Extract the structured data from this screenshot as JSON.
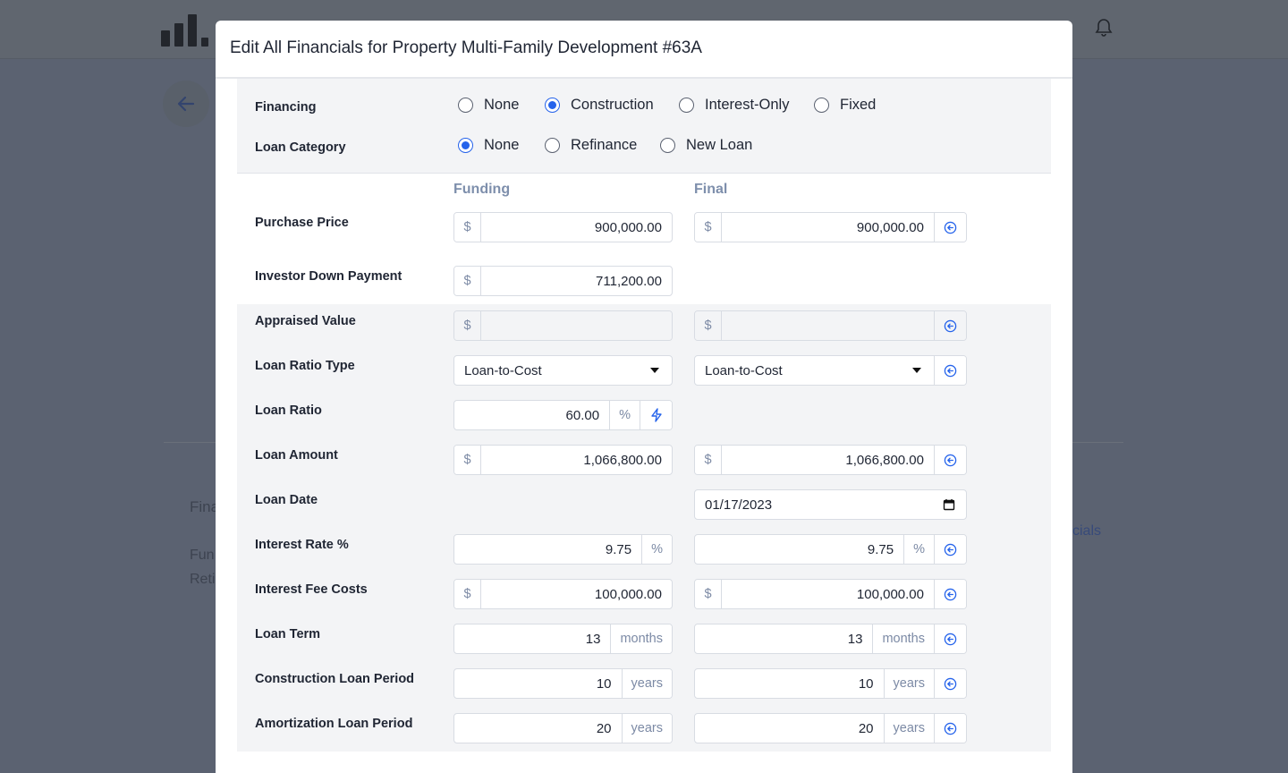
{
  "background": {
    "link_fragment": "cials",
    "section_fragment": "Fina",
    "row1_fragment": "Fun",
    "row2_fragment": "Reti"
  },
  "modal": {
    "title": "Edit All Financials for Property Multi-Family Development #63A"
  },
  "financing": {
    "label": "Financing",
    "options": [
      "None",
      "Construction",
      "Interest-Only",
      "Fixed"
    ],
    "selected": "Construction"
  },
  "loan_category": {
    "label": "Loan Category",
    "options": [
      "None",
      "Refinance",
      "New Loan"
    ],
    "selected": "None"
  },
  "columns": {
    "funding": "Funding",
    "final": "Final"
  },
  "fields": {
    "purchase_price": {
      "label": "Purchase Price",
      "currency": "$",
      "funding": "900,000.00",
      "final": "900,000.00"
    },
    "investor_down_payment": {
      "label": "Investor Down Payment",
      "currency": "$",
      "funding": "711,200.00"
    },
    "appraised_value": {
      "label": "Appraised Value",
      "currency": "$",
      "funding": "",
      "final": ""
    },
    "loan_ratio_type": {
      "label": "Loan Ratio Type",
      "funding": "Loan-to-Cost",
      "final": "Loan-to-Cost"
    },
    "loan_ratio": {
      "label": "Loan Ratio",
      "funding": "60.00",
      "unit": "%"
    },
    "loan_amount": {
      "label": "Loan Amount",
      "currency": "$",
      "funding": "1,066,800.00",
      "final": "1,066,800.00"
    },
    "loan_date": {
      "label": "Loan Date",
      "final": "01/17/2023"
    },
    "interest_rate": {
      "label": "Interest Rate %",
      "funding": "9.75",
      "final": "9.75",
      "unit": "%"
    },
    "interest_fee_costs": {
      "label": "Interest Fee Costs",
      "currency": "$",
      "funding": "100,000.00",
      "final": "100,000.00"
    },
    "loan_term": {
      "label": "Loan Term",
      "funding": "13",
      "final": "13",
      "unit": "months"
    },
    "construction_loan_period": {
      "label": "Construction Loan Period",
      "funding": "10",
      "final": "10",
      "unit": "years"
    },
    "amortization_loan_period": {
      "label": "Amortization Loan Period",
      "funding": "20",
      "final": "20",
      "unit": "years"
    }
  },
  "icons": {
    "copy_left": "arrow-left-circle-icon",
    "calculate": "lightning-icon",
    "dropdown": "caret-down-icon",
    "calendar": "calendar-icon",
    "bell": "bell-icon",
    "back": "arrow-left-icon"
  },
  "colors": {
    "accent": "#2563eb",
    "muted_label": "#7e8fac",
    "band": "#f3f4f6"
  }
}
